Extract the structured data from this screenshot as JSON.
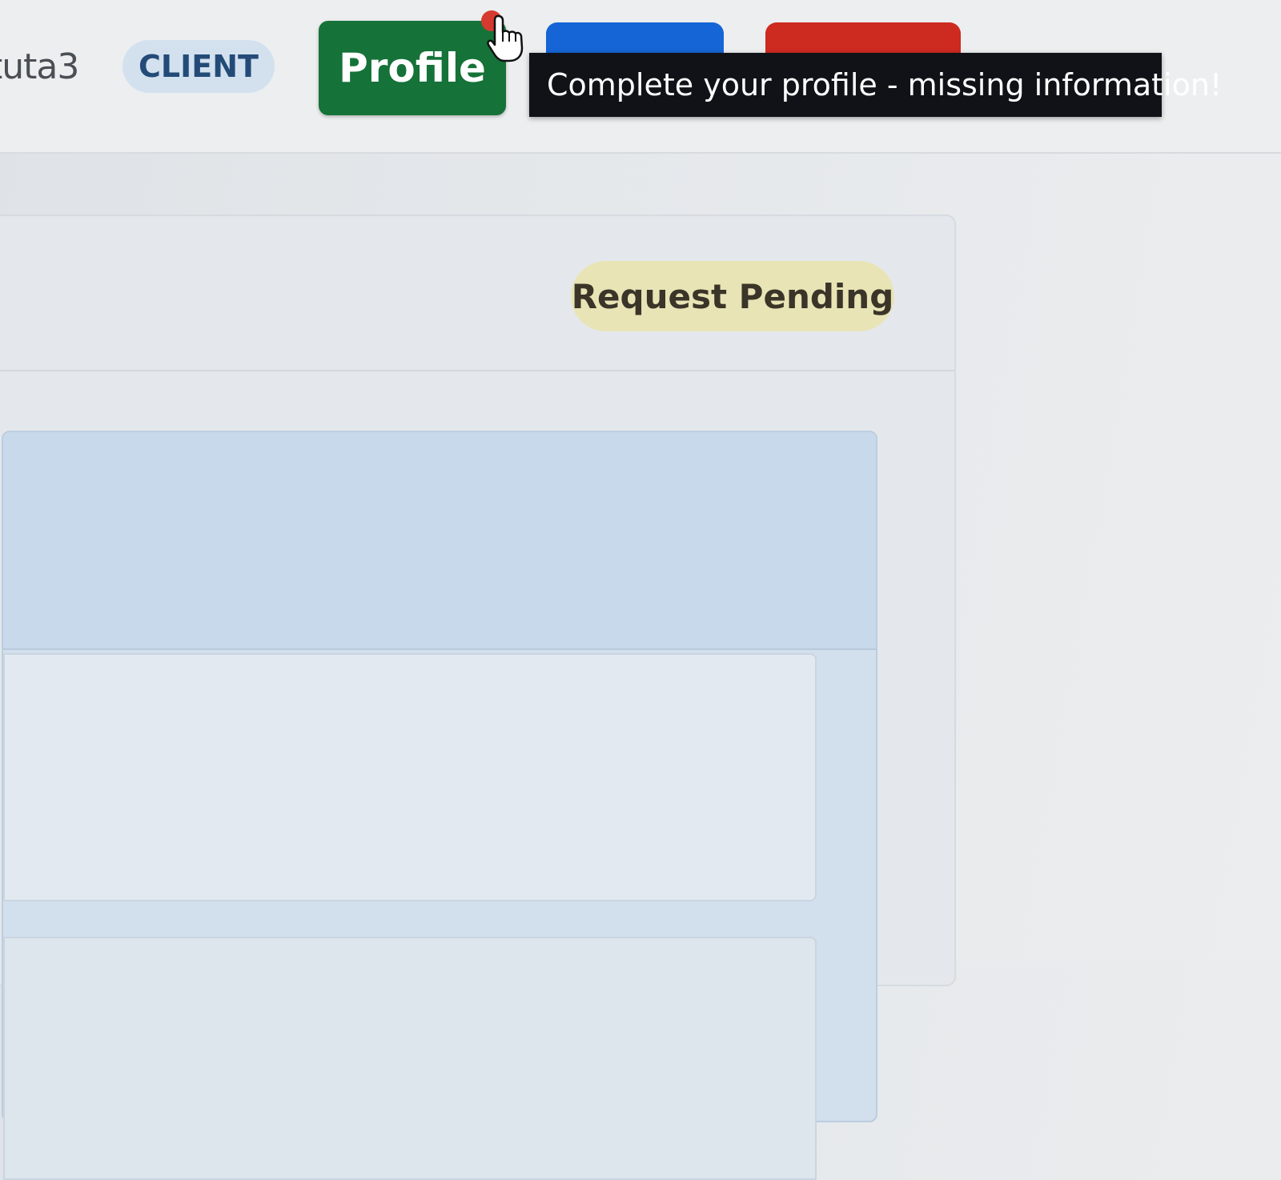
{
  "header": {
    "username": "tuta3",
    "role_badge": "CLIENT",
    "profile_button": "Profile",
    "profile_tooltip": "Complete your profile - missing information!"
  },
  "request": {
    "status_badge": "Request Pending"
  },
  "colors": {
    "profile_button": "#157238",
    "blue_button": "#1565d6",
    "red_button": "#cd2a20",
    "role_badge_bg": "#d3e1ef",
    "status_badge_bg": "#e9e4b6",
    "tooltip_bg": "#101218"
  },
  "icons": {
    "cursor": "hand-pointer-icon"
  }
}
